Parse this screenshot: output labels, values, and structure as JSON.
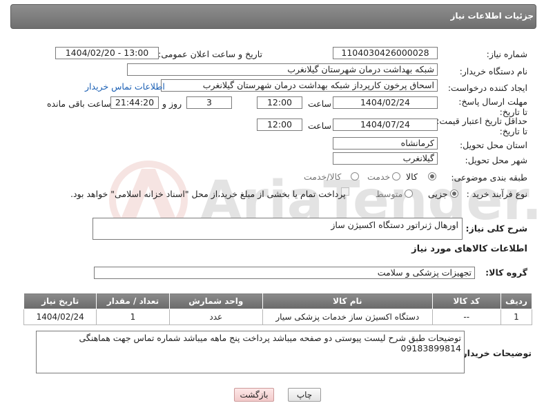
{
  "header": {
    "title": "جزئیات اطلاعات نیاز"
  },
  "form": {
    "need_number_label": "شماره نیاز:",
    "need_number": "1104030426000028",
    "announce_label": "تاریخ و ساعت اعلان عمومی:",
    "announce_value": "1404/02/20 - 13:00",
    "buyer_org_label": "نام دستگاه خریدار:",
    "buyer_org": "شبکه بهداشت درمان شهرستان گیلانغرب",
    "creator_label": "ایجاد کننده درخواست:",
    "creator": "اسحاق پرخون کارپرداز شبکه بهداشت درمان شهرستان گیلانغرب",
    "contact_link": "اطلاعات تماس خریدار",
    "deadline_label": "مهلت ارسال پاسخ: تا تاریخ:",
    "deadline_date": "1404/02/24",
    "time_label": "ساعت",
    "deadline_time": "12:00",
    "days_value": "3",
    "days_label": "روز و",
    "remaining_time": "21:44:20",
    "remaining_label": "ساعت باقی مانده",
    "validity_label": "حداقل تاریخ اعتبار قیمت: تا تاریخ:",
    "validity_date": "1404/07/24",
    "validity_time": "12:00",
    "province_label": "استان محل تحویل:",
    "province": "کرمانشاه",
    "city_label": "شهر محل تحویل:",
    "city": "گیلانغرب",
    "category_label": "طبقه بندی موضوعی:",
    "category_options": [
      "کالا",
      "خدمت",
      "کالا/خدمت"
    ],
    "category_selected": "کالا",
    "process_label": "نوع فرآیند خرید :",
    "process_options": [
      "جزیی",
      "متوسط"
    ],
    "process_selected": "جزیی",
    "payment_note": "پرداخت تمام یا بخشی از مبلغ خرید،از محل \"اسناد خزانه اسلامی\" خواهد بود."
  },
  "description": {
    "label": "شرح کلی نیاز:",
    "value": "اورهال ژنراتور دستگاه اکسیژن ساز"
  },
  "goods": {
    "section_title": "اطلاعات کالاهای مورد نیاز",
    "group_label": "گروه کالا:",
    "group_value": "تجهیزات پزشکی و سلامت",
    "columns": [
      "ردیف",
      "کد کالا",
      "نام کالا",
      "واحد شمارش",
      "تعداد / مقدار",
      "تاریخ نیاز"
    ],
    "rows": [
      [
        "1",
        "--",
        "دستگاه اکسیژن ساز خدمات پزشکی سیار",
        "عدد",
        "1",
        "1404/02/24"
      ]
    ]
  },
  "buyer_notes": {
    "label": "توضیحات خریدار:",
    "value": "توضیحات طبق شرح لیست پیوستی دو صفحه میباشد پرداخت پنج ماهه میباشد شماره تماس جهت هماهنگی 09183899814"
  },
  "watermark": {
    "text": "AriaTender.neT"
  },
  "buttons": {
    "print": "چاپ",
    "back": "بازگشت"
  },
  "colors": {
    "header_bg": "#7d7d7d",
    "link": "#1a5fb4",
    "watermark": "#c0392b"
  }
}
